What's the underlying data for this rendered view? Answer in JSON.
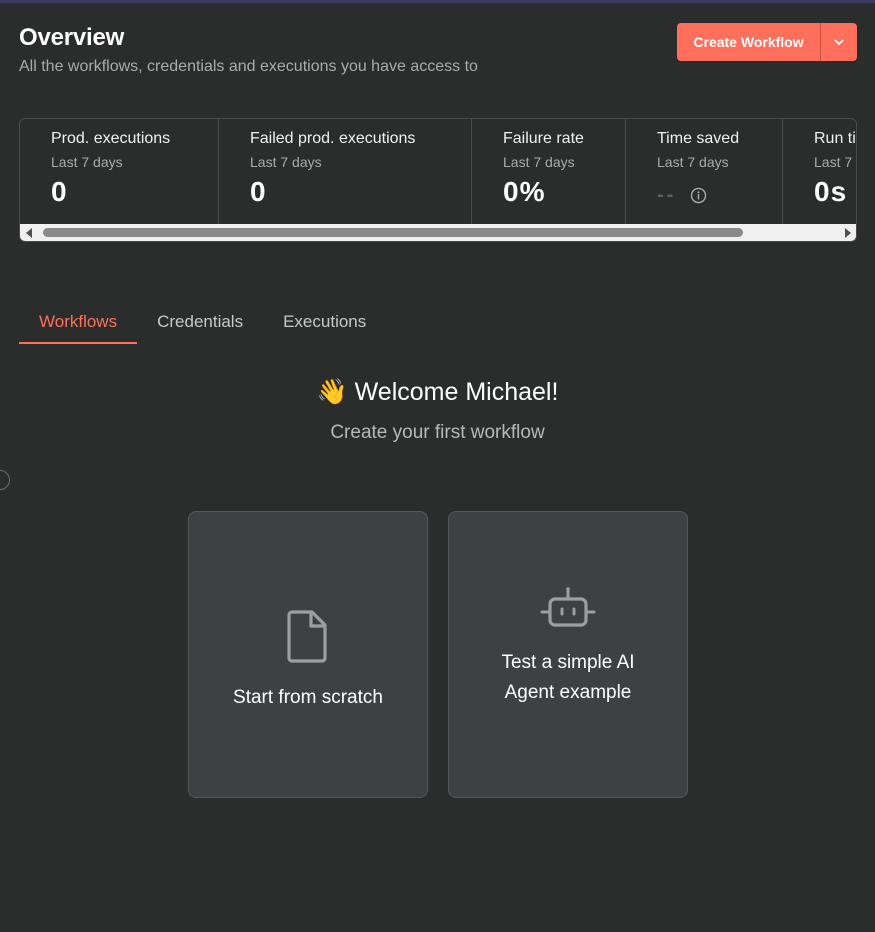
{
  "header": {
    "title": "Overview",
    "subtitle": "All the workflows, credentials and executions you have access to"
  },
  "create": {
    "label": "Create Workflow",
    "accent": "#ff6f5c",
    "caret_icon": "chevron-down-icon"
  },
  "stats": [
    {
      "label": "Prod. executions",
      "period": "Last 7 days",
      "value": "0"
    },
    {
      "label": "Failed prod. executions",
      "period": "Last 7 days",
      "value": "0"
    },
    {
      "label": "Failure rate",
      "period": "Last 7 days",
      "value": "0%"
    },
    {
      "label": "Time saved",
      "period": "Last 7 days",
      "value": "--",
      "icon": "info-icon"
    },
    {
      "label": "Run ti",
      "period": "Last 7",
      "value": "0s"
    }
  ],
  "tabs": [
    {
      "label": "Workflows",
      "active": true
    },
    {
      "label": "Credentials",
      "active": false
    },
    {
      "label": "Executions",
      "active": false
    }
  ],
  "welcome": {
    "emoji": "👋",
    "title": "Welcome Michael!",
    "subtitle": "Create your first workflow"
  },
  "cards": [
    {
      "label": "Start from scratch",
      "icon": "file-icon"
    },
    {
      "label_line1": "Test a simple AI",
      "label_line2": "Agent example",
      "icon": "robot-icon"
    }
  ]
}
